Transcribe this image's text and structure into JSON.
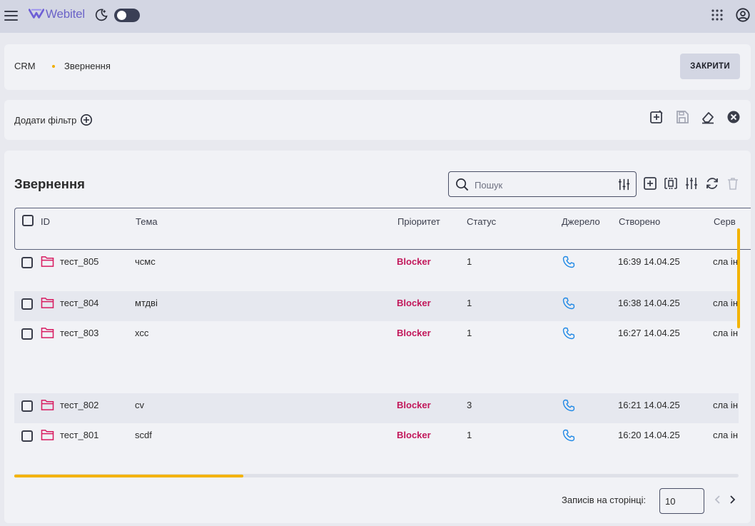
{
  "topbar": {
    "logo_text": "Webitel",
    "icons": [
      "menu-icon",
      "webitel-logo",
      "moon-icon",
      "theme-toggle",
      "apps-grid-icon",
      "account-circle-icon"
    ]
  },
  "breadcrumb": {
    "items": [
      "CRM",
      "Звернення"
    ],
    "close_label": "ЗАКРИТИ"
  },
  "filters": {
    "add_label": "Додати фільтр",
    "tools": [
      "filter-apply-icon",
      "save-icon",
      "eraser-icon",
      "close-circle-icon"
    ]
  },
  "main": {
    "title": "Звернення",
    "search_placeholder": "Пошук",
    "columns": [
      "ID",
      "Тема",
      "Пріоритет",
      "Статус",
      "Джерело",
      "Створено",
      "Серв"
    ],
    "rows": [
      {
        "id": "тест_805",
        "subject": "чсмс",
        "priority": "Blocker",
        "status": "1",
        "created": "16:39 14.04.25",
        "service": "сла ін"
      },
      {
        "id": "тест_804",
        "subject": "мтдві",
        "priority": "Blocker",
        "status": "1",
        "created": "16:38 14.04.25",
        "service": "сла ін"
      },
      {
        "id": "тест_803",
        "subject": "хсс",
        "priority": "Blocker",
        "status": "1",
        "created": "16:27 14.04.25",
        "service": "сла ін"
      },
      {
        "id": "тест_802",
        "subject": "cv",
        "priority": "Blocker",
        "status": "3",
        "created": "16:21 14.04.25",
        "service": "сла ін"
      },
      {
        "id": "тест_801",
        "subject": "scdf",
        "priority": "Blocker",
        "status": "1",
        "created": "16:20 14.04.25",
        "service": "сла ін"
      }
    ],
    "pagination": {
      "per_page_label": "Записів на сторінці:",
      "per_page_value": "10"
    }
  },
  "colors": {
    "accent": "#f3b300",
    "priority_blocker": "#c2185b",
    "source_phone": "#1e88e5",
    "folder_icon": "#d81b60"
  }
}
